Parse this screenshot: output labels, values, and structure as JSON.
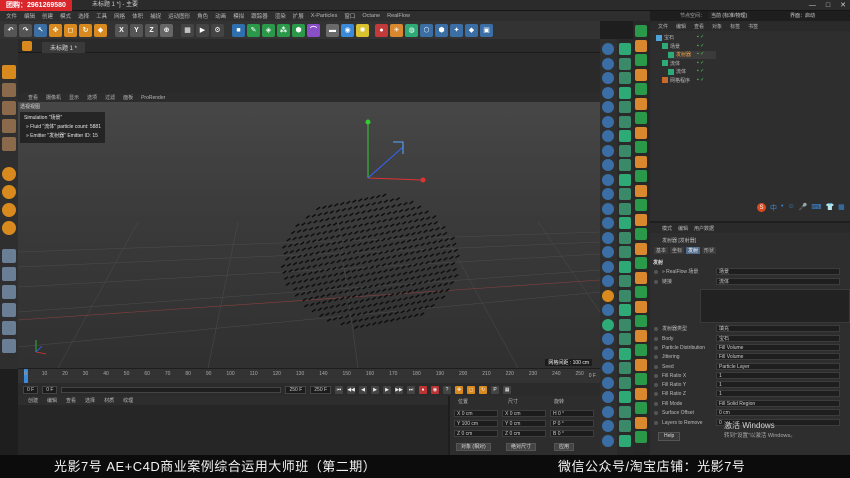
{
  "window": {
    "watermark": "团购：2961269580",
    "title": "未标题 1 *] - 主要",
    "controls": [
      "—",
      "□",
      "✕"
    ]
  },
  "menu": [
    "文件",
    "编辑",
    "创建",
    "模式",
    "选择",
    "工具",
    "网格",
    "体积",
    "捕捉",
    "运动图形",
    "角色",
    "动画",
    "模拟",
    "跟踪器",
    "渲染",
    "扩展",
    "X-Particles",
    "窗口",
    "Octane",
    "RealFlow"
  ],
  "right_top_label": "节点空间：",
  "right_top_value": "当前 (标准/物理)",
  "right_top_layout": "界面：启动",
  "doc_tab": "未标题 1 *",
  "viewport": {
    "menu": [
      "查看",
      "摄像机",
      "显示",
      "选项",
      "过滤",
      "面板",
      "ProRender"
    ],
    "label": "透视视图",
    "info_title": "Simulation \"场景\"",
    "info_lines": [
      "» Fluid \"流体\" particle count: 5881",
      "» Emitter \"发射器\" Emitter ID: 15"
    ],
    "scale": "网格间距 : 100 cm"
  },
  "timeline": {
    "ticks": [
      "0",
      "5",
      "10",
      "15",
      "20",
      "25",
      "30",
      "35",
      "40",
      "45",
      "50",
      "55",
      "60",
      "65",
      "70",
      "75",
      "80",
      "85",
      "90",
      "95",
      "100",
      "105",
      "110",
      "115",
      "120",
      "125",
      "130",
      "135",
      "140",
      "145",
      "150",
      "155",
      "160",
      "165",
      "170",
      "175",
      "180",
      "185",
      "190",
      "195",
      "200",
      "205",
      "210",
      "215",
      "220",
      "225",
      "230",
      "235",
      "240",
      "245",
      "250"
    ],
    "end_label": "0 F"
  },
  "playback": {
    "current_frame": "0 F",
    "start_frame": "0 F",
    "end_frame": "250 F",
    "max_frame": "250 F"
  },
  "material_menu": [
    "创建",
    "编辑",
    "查看",
    "选择",
    "材质",
    "纹理"
  ],
  "coords": {
    "headers": [
      "位置",
      "尺寸",
      "旋转"
    ],
    "rows": [
      [
        "X  0 cm",
        "X  0 cm",
        "H  0 °"
      ],
      [
        "Y  100 cm",
        "Y  0 cm",
        "P  0 °"
      ],
      [
        "Z  0 cm",
        "Z  0 cm",
        "B  0 °"
      ]
    ],
    "mode": "对象 (相对)",
    "size_mode": "绝对尺寸",
    "apply": "应用"
  },
  "object_manager": {
    "menu": [
      "文件",
      "编辑",
      "查看",
      "对象",
      "标签",
      "书签"
    ],
    "items": [
      {
        "label": "宝石",
        "indent": 0,
        "color": "#4fa3d9"
      },
      {
        "label": "场景",
        "indent": 1,
        "color": "#2eaa77"
      },
      {
        "label": "发射器",
        "indent": 2,
        "color": "#2eaa77",
        "selected": true
      },
      {
        "label": "流体",
        "indent": 1,
        "color": "#2eaa77"
      },
      {
        "label": "流体",
        "indent": 2,
        "color": "#2eaa77"
      },
      {
        "label": "网格程序",
        "indent": 1,
        "color": "#c86a2c"
      }
    ]
  },
  "attributes": {
    "menu": [
      "模式",
      "编辑",
      "用户数据"
    ],
    "object_title": "发射器 [发射器]",
    "tabs": [
      "基本",
      "坐标",
      "发射",
      "形状"
    ],
    "section": "发射",
    "rows": [
      {
        "label": "» RealFlow 场景",
        "value": "场景"
      },
      {
        "label": "链接",
        "value": "流体"
      },
      {
        "label": "发射器类型",
        "value": "填充"
      },
      {
        "label": "Body",
        "value": "宝石"
      },
      {
        "label": "Particle Distribution",
        "value": "Fill Volume"
      },
      {
        "label": "Jittering",
        "value": "Fill Volume"
      },
      {
        "label": "Seed",
        "value": "Particle Layer"
      },
      {
        "label": "Fill Ratio X",
        "value": "1"
      },
      {
        "label": "Fill Ratio Y",
        "value": "1"
      },
      {
        "label": "Fill Ratio Z",
        "value": "1"
      },
      {
        "label": "Fill Mode",
        "value": "Fill Solid Region"
      },
      {
        "label": "Surface Offset",
        "value": "0 cm"
      },
      {
        "label": "Layers to Remove",
        "value": "0"
      }
    ],
    "help": "Help"
  },
  "ime": [
    "S",
    "中",
    "•",
    "☺",
    "🎤",
    "⌨",
    "👕",
    "▦"
  ],
  "activation": {
    "line1": "激活 Windows",
    "line2": "转到\"设置\"以激活 Windows。"
  },
  "banner": {
    "left": "光影7号 AE+C4D商业案例综合运用大师班（第二期）",
    "right": "微信公众号/淘宝店铺：光影7号"
  },
  "colors": {
    "accent": "#4f6a8a",
    "watermark_red": "#d9262b",
    "axis_x": "#d33",
    "axis_y": "#3c3",
    "axis_z": "#36f"
  }
}
